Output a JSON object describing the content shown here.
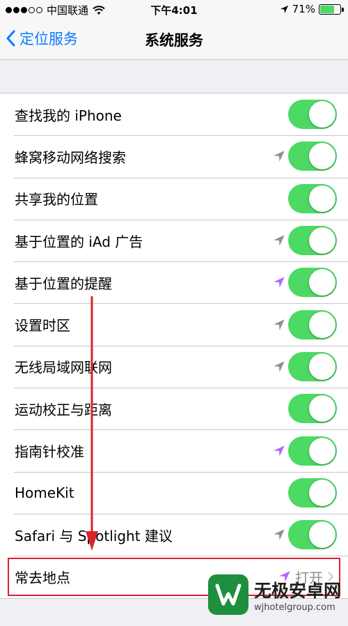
{
  "status": {
    "carrier": "中国联通",
    "time": "下午4:01",
    "battery": "71%",
    "battery_level": 0.71,
    "signal_bars": 3
  },
  "nav": {
    "back_label": "定位服务",
    "title": "系统服务"
  },
  "rows": [
    {
      "label": "查找我的 iPhone",
      "loc": "none",
      "toggle": true
    },
    {
      "label": "蜂窝移动网络搜索",
      "loc": "gray",
      "toggle": true
    },
    {
      "label": "共享我的位置",
      "loc": "none",
      "toggle": true
    },
    {
      "label": "基于位置的 iAd 广告",
      "loc": "gray",
      "toggle": true
    },
    {
      "label": "基于位置的提醒",
      "loc": "purple",
      "toggle": true
    },
    {
      "label": "设置时区",
      "loc": "gray",
      "toggle": true
    },
    {
      "label": "无线局域网联网",
      "loc": "gray",
      "toggle": true
    },
    {
      "label": "运动校正与距离",
      "loc": "none",
      "toggle": true
    },
    {
      "label": "指南针校准",
      "loc": "purple",
      "toggle": true
    },
    {
      "label": "HomeKit",
      "loc": "none",
      "toggle": true
    },
    {
      "label": "Safari 与 Spotlight 建议",
      "loc": "gray",
      "toggle": true
    }
  ],
  "frequent": {
    "label": "常去地点",
    "value": "打开",
    "loc": "purple"
  },
  "watermark": {
    "name": "无极安卓网",
    "url": "wjhotelgroup.com"
  },
  "colors": {
    "accent": "#0a7aff",
    "toggle_on": "#4cd964",
    "loc_gray": "#8e8e93",
    "loc_purple": "#b266ff",
    "annotation": "#d9232d"
  }
}
